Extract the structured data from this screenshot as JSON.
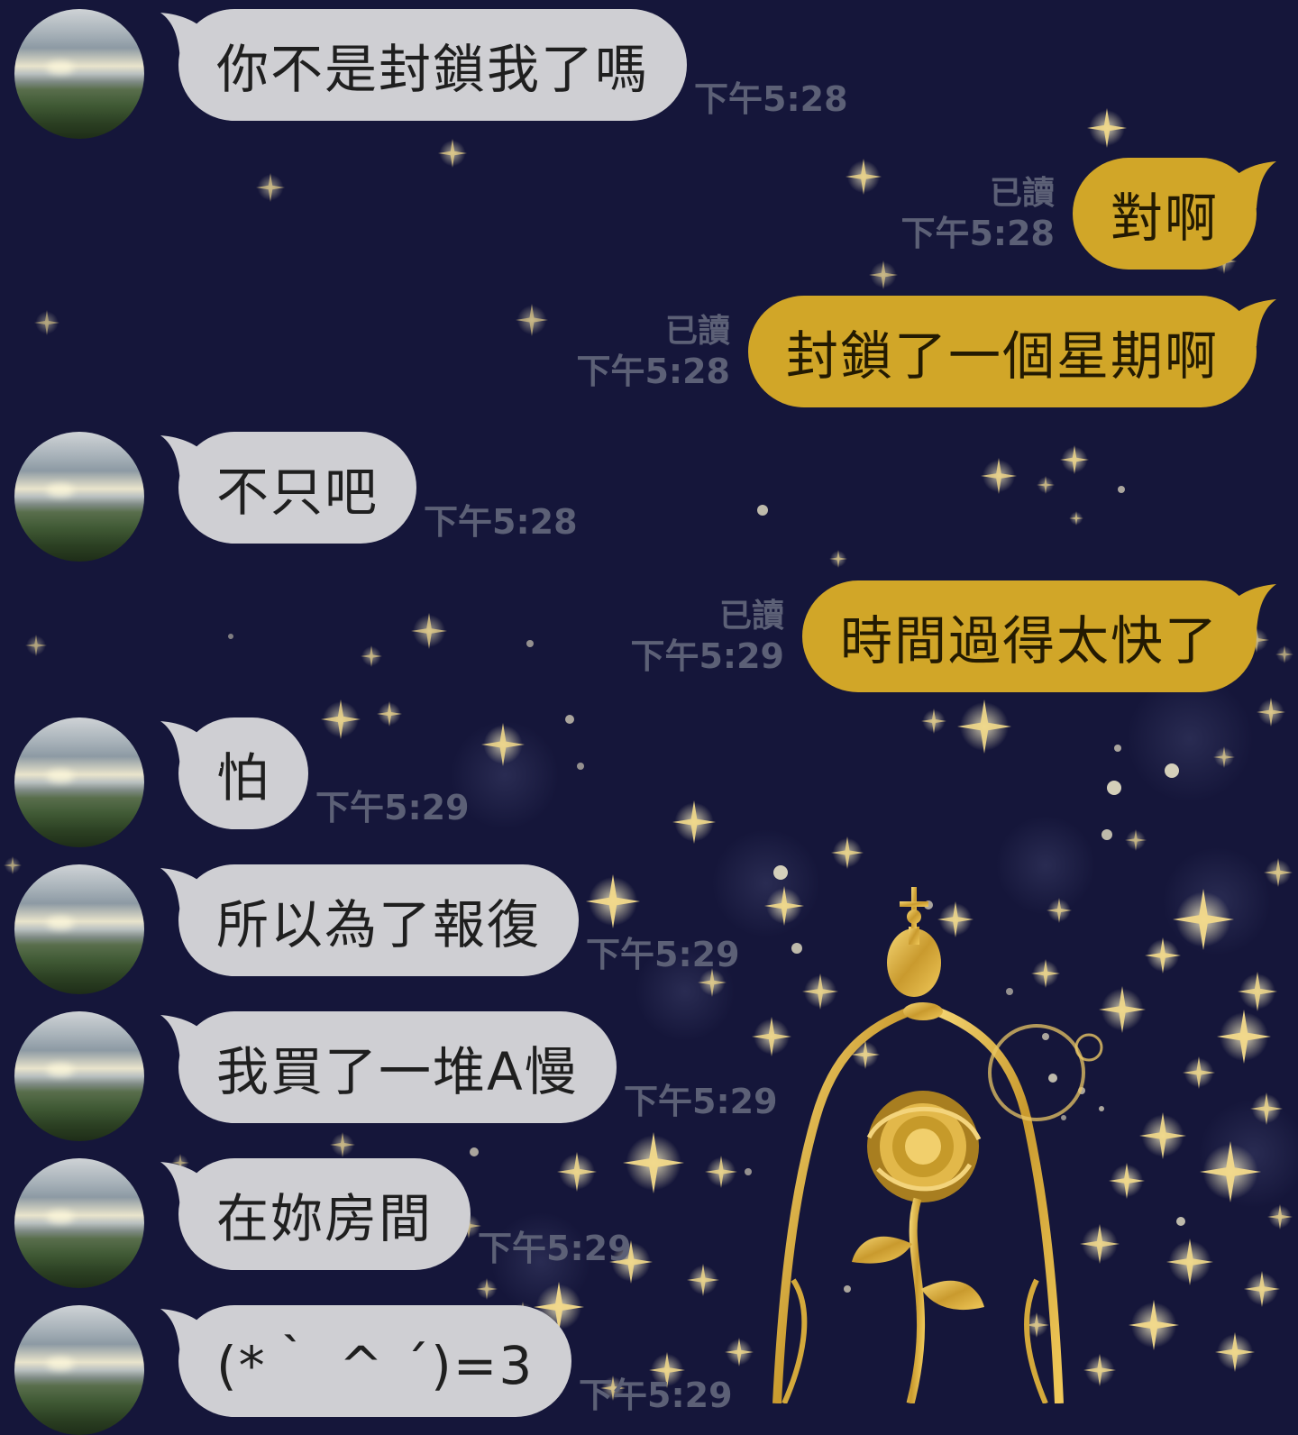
{
  "chat": {
    "colors": {
      "background": "#15163a",
      "incoming_bubble": "#cfcfd3",
      "outgoing_bubble": "#d1a628",
      "meta_text": "#5c6076",
      "sparkle": "#f2d98a"
    },
    "avatar_icon": "profile-photo-landscape",
    "messages": [
      {
        "side": "in",
        "text": "你不是封鎖我了嗎",
        "time": "下午5:28"
      },
      {
        "side": "out",
        "text": "對啊",
        "read": "已讀",
        "time": "下午5:28"
      },
      {
        "side": "out",
        "text": "封鎖了一個星期啊",
        "read": "已讀",
        "time": "下午5:28"
      },
      {
        "side": "in",
        "text": "不只吧",
        "time": "下午5:28"
      },
      {
        "side": "out",
        "text": "時間過得太快了",
        "read": "已讀",
        "time": "下午5:29"
      },
      {
        "side": "in",
        "text": "怕",
        "time": "下午5:29"
      },
      {
        "side": "in",
        "text": "所以為了報復",
        "time": "下午5:29"
      },
      {
        "side": "in",
        "text": "我買了一堆A慢",
        "time": "下午5:29"
      },
      {
        "side": "in",
        "text": "在妳房間",
        "time": "下午5:29"
      },
      {
        "side": "in",
        "text": "(*｀ ^ ´)=3",
        "time": "下午5:29"
      }
    ]
  }
}
